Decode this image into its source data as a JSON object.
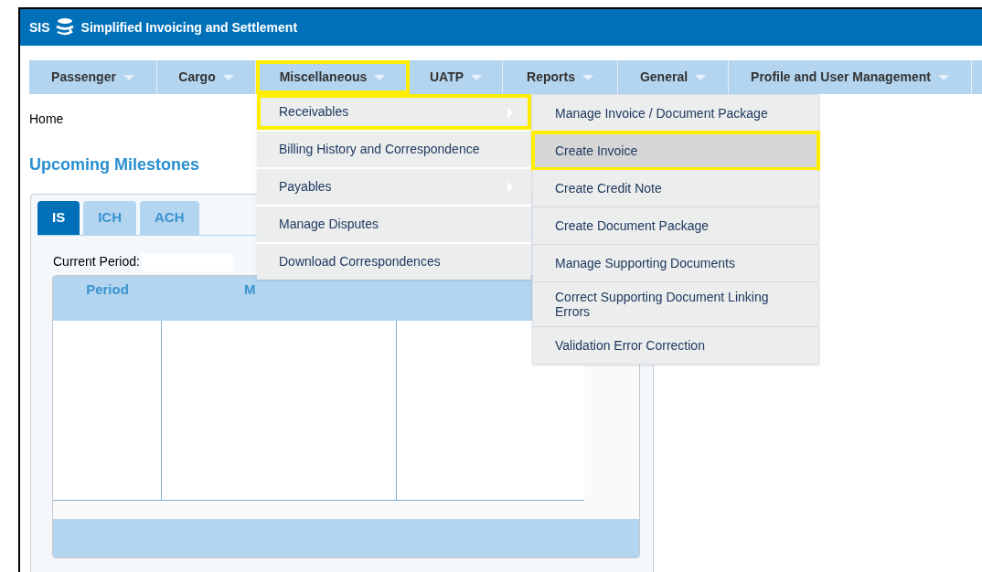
{
  "header": {
    "logo_text": "SIS",
    "title": "Simplified Invoicing and Settlement"
  },
  "nav": [
    {
      "label": "Passenger",
      "highlighted": false
    },
    {
      "label": "Cargo",
      "highlighted": false
    },
    {
      "label": "Miscellaneous",
      "highlighted": true
    },
    {
      "label": "UATP",
      "highlighted": false
    },
    {
      "label": "Reports",
      "highlighted": false
    },
    {
      "label": "General",
      "highlighted": false
    },
    {
      "label": "Profile and User Management",
      "highlighted": false
    }
  ],
  "breadcrumb": "Home",
  "section_title": "Upcoming Milestones",
  "tabs": [
    {
      "label": "IS",
      "selected": true
    },
    {
      "label": "ICH",
      "selected": false
    },
    {
      "label": "ACH",
      "selected": false
    }
  ],
  "current_period_label": "Current Period:",
  "table": {
    "columns": [
      "Period",
      "M"
    ]
  },
  "menu": [
    {
      "label": "Receivables",
      "has_submenu": true,
      "highlighted": true
    },
    {
      "label": "Billing History and Correspondence",
      "has_submenu": false,
      "highlighted": false
    },
    {
      "label": "Payables",
      "has_submenu": true,
      "highlighted": false
    },
    {
      "label": "Manage Disputes",
      "has_submenu": false,
      "highlighted": false
    },
    {
      "label": "Download Correspondences",
      "has_submenu": false,
      "highlighted": false
    }
  ],
  "submenu": [
    {
      "label": "Manage Invoice / Document Package",
      "highlighted": false
    },
    {
      "label": "Create Invoice",
      "highlighted": true
    },
    {
      "label": "Create Credit Note",
      "highlighted": false
    },
    {
      "label": "Create Document Package",
      "highlighted": false
    },
    {
      "label": "Manage Supporting Documents",
      "highlighted": false
    },
    {
      "label": "Correct Supporting Document Linking Errors",
      "highlighted": false
    },
    {
      "label": "Validation Error Correction",
      "highlighted": false
    }
  ]
}
